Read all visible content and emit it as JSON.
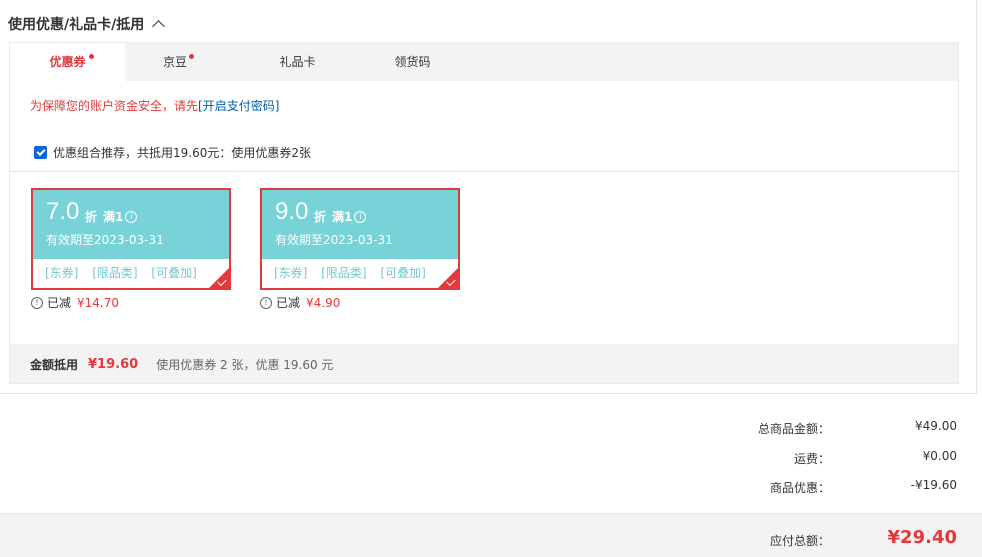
{
  "section": {
    "title": "使用优惠/礼品卡/抵用"
  },
  "tabs": [
    {
      "label": "优惠券",
      "active": true,
      "dot": true
    },
    {
      "label": "京豆",
      "active": false,
      "dot": true
    },
    {
      "label": "礼品卡",
      "active": false,
      "dot": false
    },
    {
      "label": "领货码",
      "active": false,
      "dot": false
    }
  ],
  "security": {
    "text": "为保障您的账户资金安全，请先",
    "link": "[开启支付密码]"
  },
  "recommend": {
    "checked": true,
    "label": "优惠组合推荐，共抵用19.60元：使用优惠券2张"
  },
  "coupons": [
    {
      "value": "7.0",
      "unit": "折",
      "cond": "满1",
      "validity": "有效期至2023-03-31",
      "tags": [
        "[东券]",
        "[限品类]",
        "[可叠加]"
      ],
      "saved_label": "已减",
      "saved_amount": "¥14.70",
      "selected": true
    },
    {
      "value": "9.0",
      "unit": "折",
      "cond": "满1",
      "validity": "有效期至2023-03-31",
      "tags": [
        "[东券]",
        "[限品类]",
        "[可叠加]"
      ],
      "saved_label": "已减",
      "saved_amount": "¥4.90",
      "selected": true
    }
  ],
  "summary": {
    "label": "金额抵用",
    "amount": "¥19.60",
    "note": "使用优惠券 2 张，优惠 19.60 元"
  },
  "totals": [
    {
      "label": "总商品金额：",
      "value": "¥49.00"
    },
    {
      "label": "运费：",
      "value": "¥0.00"
    },
    {
      "label": "商品优惠：",
      "value": "-¥19.60"
    }
  ],
  "payable": {
    "label": "应付总额：",
    "value": "¥29.40"
  },
  "colors": {
    "accent": "#e4393c",
    "coupon_bg": "#77d3d8",
    "link": "#005ea7",
    "checkbox": "#0a66d8"
  }
}
